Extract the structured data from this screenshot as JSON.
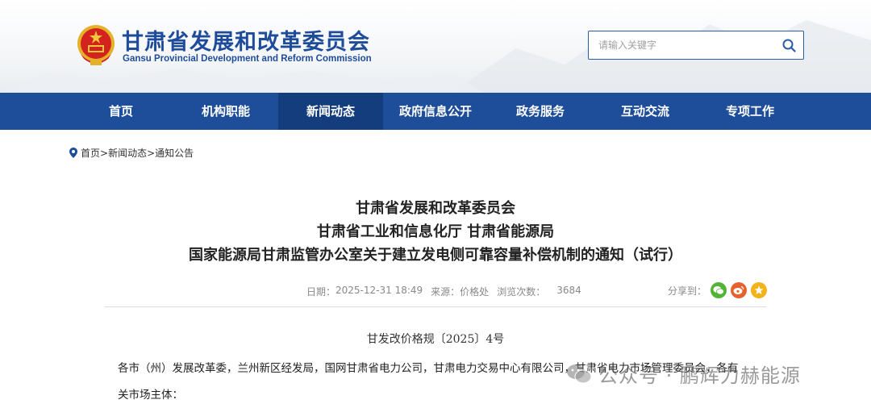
{
  "header": {
    "title": "甘肃省发展和改革委员会",
    "subtitle": "Gansu Provincial Development and Reform Commission",
    "search_placeholder": "请输入关键字"
  },
  "nav": {
    "items": [
      {
        "label": "首页"
      },
      {
        "label": "机构职能"
      },
      {
        "label": "新闻动态",
        "active": true
      },
      {
        "label": "政府信息公开"
      },
      {
        "label": "政务服务"
      },
      {
        "label": "互动交流"
      },
      {
        "label": "专项工作"
      }
    ]
  },
  "breadcrumb": {
    "home": "首页",
    "sep1": ">",
    "section": "新闻动态",
    "sep2": ">",
    "current": "通知公告"
  },
  "article": {
    "title_lines": [
      "甘肃省发展和改革委员会",
      "甘肃省工业和信息化厅 甘肃省能源局",
      "国家能源局甘肃监管办公室关于建立发电侧可靠容量补偿机制的通知（试行）"
    ],
    "date_label": "日期：",
    "date": "2025-12-31 18:49",
    "source_label": "来源：",
    "source": "价格处",
    "views_label": "浏览次数：",
    "views": "3684",
    "share_label": "分享到：",
    "doc_number": "甘发改价格规〔2025〕4号",
    "body_lines": [
      "各市（州）发展改革委，兰州新区经发局，国网甘肃省电力公司，甘肃电力交易中心有限公司，甘肃省电力市场管理委员会，各有",
      "关市场主体："
    ]
  },
  "watermark": {
    "text": "公众号 · 鹏辉力赫能源"
  },
  "colors": {
    "brand_blue": "#1e4e99",
    "nav_active": "#143d7d",
    "wechat_green": "#52b436",
    "weibo_orange": "#e8612c",
    "qzone_yellow": "#f3b21b"
  },
  "icons": [
    "national-emblem-icon",
    "search-icon",
    "location-pin-icon",
    "wechat-icon",
    "weibo-icon",
    "qzone-icon"
  ]
}
